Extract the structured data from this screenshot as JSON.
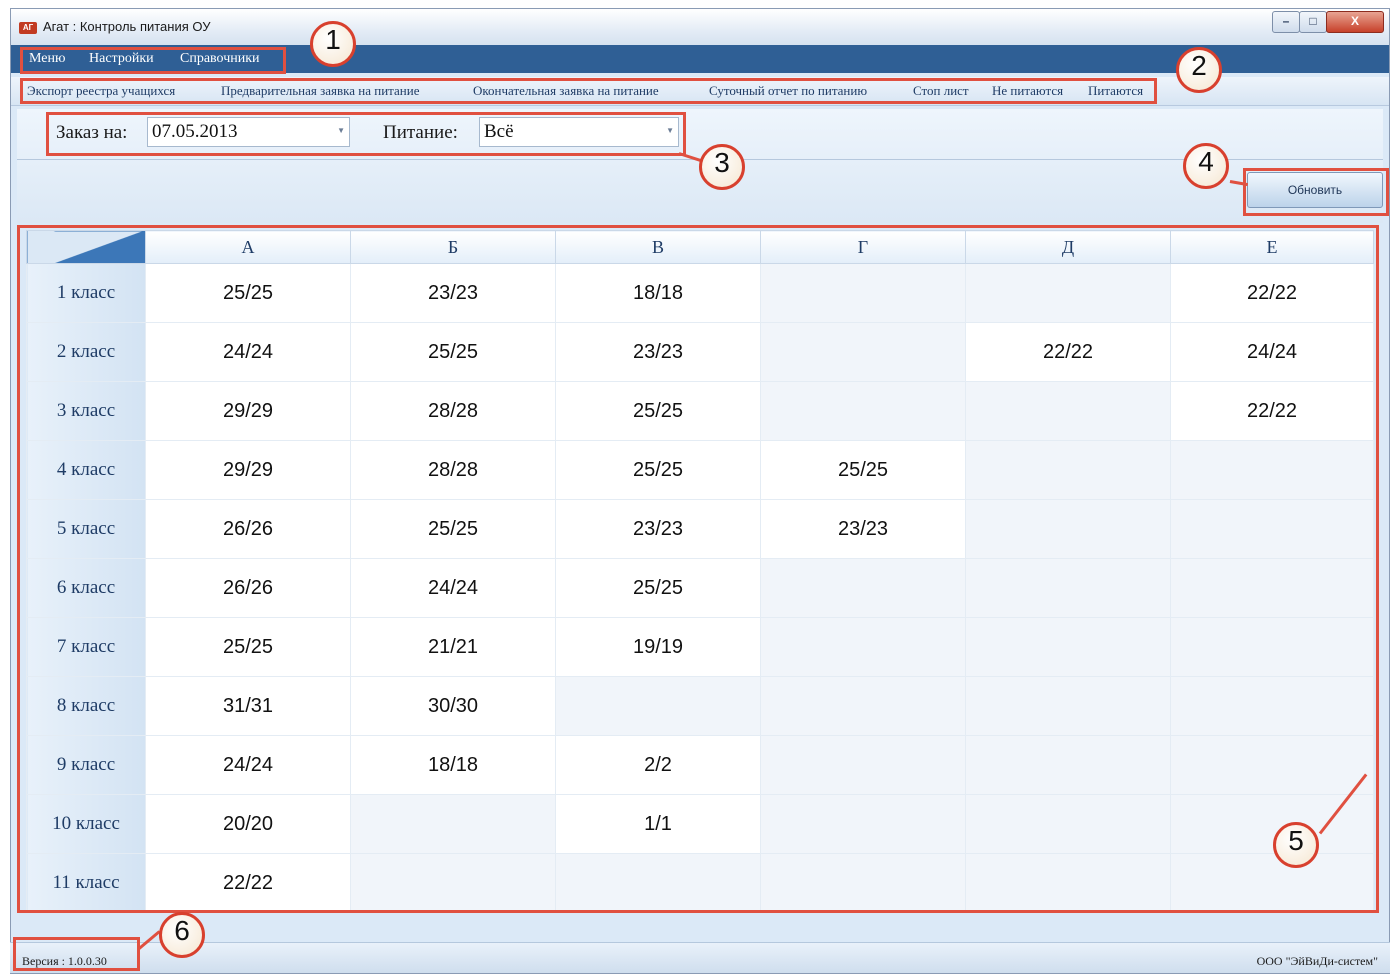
{
  "window": {
    "title": "Агат : Контроль питания ОУ",
    "app_icon": "АГ"
  },
  "window_controls": {
    "minimize": "–",
    "maximize": "□",
    "close": "X"
  },
  "menu": [
    "Меню",
    "Настройки",
    "Справочники"
  ],
  "toolbar": [
    "Экспорт реестра учащихся",
    "Предварительная заявка на питание",
    "Окончательная заявка на питание",
    "Суточный отчет по питанию",
    "Стоп лист",
    "Не питаются",
    "Питаются"
  ],
  "filters": {
    "order_label": "Заказ на:",
    "order_value": "07.05.2013",
    "meal_label": "Питание:",
    "meal_value": "Всё"
  },
  "refresh_button": "Обновить",
  "table": {
    "columns": [
      "А",
      "Б",
      "В",
      "Г",
      "Д",
      "Е"
    ],
    "rows": [
      {
        "label": "1 класс",
        "cells": [
          "25/25",
          "23/23",
          "18/18",
          "",
          "",
          "22/22"
        ]
      },
      {
        "label": "2 класс",
        "cells": [
          "24/24",
          "25/25",
          "23/23",
          "",
          "22/22",
          "24/24"
        ]
      },
      {
        "label": "3 класс",
        "cells": [
          "29/29",
          "28/28",
          "25/25",
          "",
          "",
          "22/22"
        ]
      },
      {
        "label": "4 класс",
        "cells": [
          "29/29",
          "28/28",
          "25/25",
          "25/25",
          "",
          ""
        ]
      },
      {
        "label": "5 класс",
        "cells": [
          "26/26",
          "25/25",
          "23/23",
          "23/23",
          "",
          ""
        ]
      },
      {
        "label": "6 класс",
        "cells": [
          "26/26",
          "24/24",
          "25/25",
          "",
          "",
          ""
        ]
      },
      {
        "label": "7 класс",
        "cells": [
          "25/25",
          "21/21",
          "19/19",
          "",
          "",
          ""
        ]
      },
      {
        "label": "8 класс",
        "cells": [
          "31/31",
          "30/30",
          "",
          "",
          "",
          ""
        ]
      },
      {
        "label": "9 класс",
        "cells": [
          "24/24",
          "18/18",
          "2/2",
          "",
          "",
          ""
        ]
      },
      {
        "label": "10 класс",
        "cells": [
          "20/20",
          "",
          "1/1",
          "",
          "",
          ""
        ]
      },
      {
        "label": "11 класс",
        "cells": [
          "22/22",
          "",
          "",
          "",
          "",
          ""
        ]
      }
    ]
  },
  "status": {
    "version": "Версия : 1.0.0.30",
    "company": "ООО \"ЭйВиДи-систем\""
  },
  "callouts": [
    "1",
    "2",
    "3",
    "4",
    "5",
    "6"
  ],
  "colors": {
    "menubar": "#2f5f95",
    "highlight": "#e05040",
    "window_bg": "#dbe9f7"
  }
}
